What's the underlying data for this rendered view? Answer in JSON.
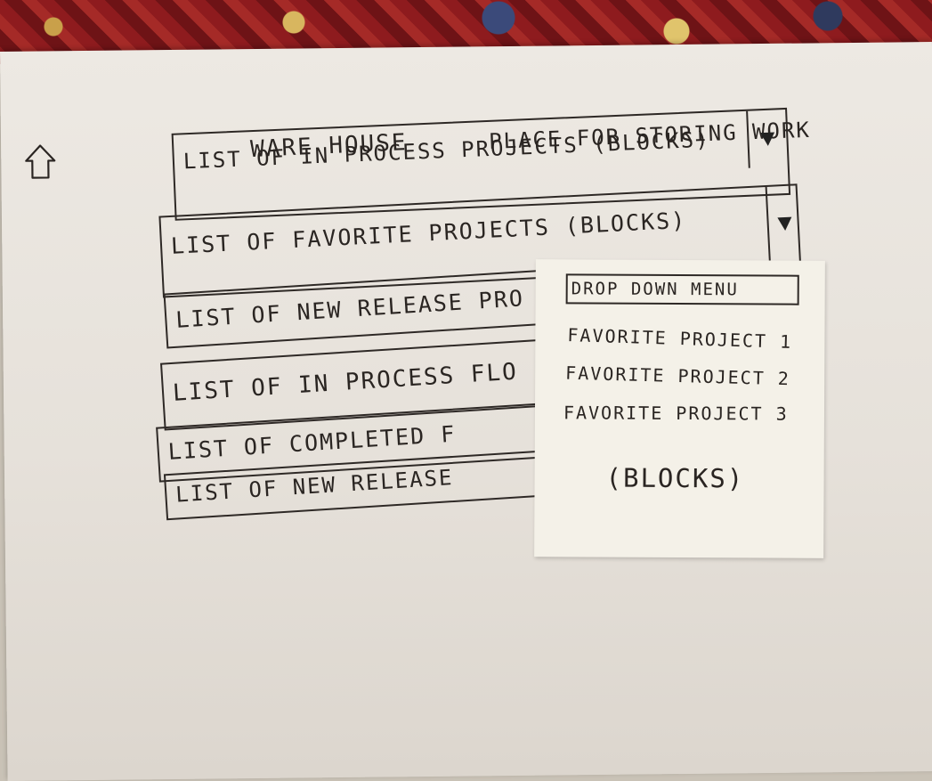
{
  "header": {
    "title": "WARE HOUSE",
    "subtitle": "PLACE FOR STORING WORK"
  },
  "lists": [
    {
      "label": "LIST OF IN PROCESS PROJECTS (BLOCKS)",
      "has_dropdown": true
    },
    {
      "label": "LIST OF FAVORITE PROJECTS (BLOCKS)",
      "has_dropdown": true
    },
    {
      "label": "LIST OF NEW RELEASE PRO"
    },
    {
      "label": "LIST OF IN PROCESS FLO"
    },
    {
      "label": "LIST OF COMPLETED F"
    },
    {
      "label": "LIST OF NEW RELEASE"
    }
  ],
  "dropdown": {
    "title": "DROP DOWN MENU",
    "items": [
      "FAVORITE PROJECT 1",
      "FAVORITE PROJECT 2",
      "FAVORITE PROJECT 3"
    ],
    "footer": "(BLOCKS)"
  },
  "icons": {
    "home": "house-outline-icon",
    "dropdown": "triangle-down-icon"
  }
}
